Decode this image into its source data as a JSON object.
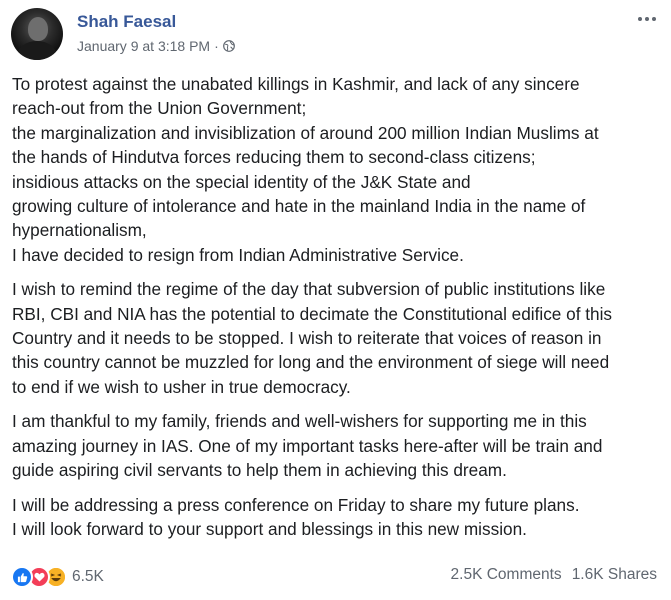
{
  "post": {
    "author": "Shah Faesal",
    "timestamp": "January 9 at 3:18 PM",
    "separator": "·",
    "privacy_icon": "globe-icon",
    "more_icon": "more-options-icon",
    "paragraphs": [
      {
        "lines": [
          "To protest against the unabated killings in Kashmir, and lack of any sincere",
          "reach-out from the Union Government;",
          "the marginalization and invisiblization of around 200 million Indian Muslims at",
          "the hands of Hindutva forces reducing them to second-class citizens;",
          "insidious attacks on the special identity of the J&K State and",
          "growing culture of intolerance and hate in the mainland India in the name of",
          "hypernationalism,",
          "I have decided to resign from Indian Administrative Service."
        ]
      },
      {
        "lines": [
          "I wish to remind the regime of the day that subversion of public institutions like",
          "RBI, CBI and NIA has the potential to decimate the Constitutional edifice of this",
          "Country and it needs to be stopped. I wish to reiterate that voices of reason in",
          "this country cannot be muzzled for long and the environment of siege will need",
          "to end if we wish to usher in true democracy."
        ]
      },
      {
        "lines": [
          "I am thankful to my family, friends and well-wishers for supporting me in this",
          "amazing journey in IAS. One of my important tasks here-after will be train and",
          "guide aspiring civil servants to help them in achieving this dream."
        ]
      },
      {
        "lines": [
          "I will be addressing a press conference on Friday to share my future plans.",
          "I will look forward to your support and blessings in this new mission."
        ]
      }
    ]
  },
  "footer": {
    "reactions_count": "6.5K",
    "reaction_icons": [
      "like-icon",
      "love-icon",
      "haha-icon"
    ],
    "comments": "2.5K Comments",
    "shares": "1.6K Shares"
  },
  "colors": {
    "author_link": "#385898",
    "meta_text": "#606770",
    "like": "#1877f2",
    "love": "#f33e58",
    "haha": "#f7b125"
  }
}
